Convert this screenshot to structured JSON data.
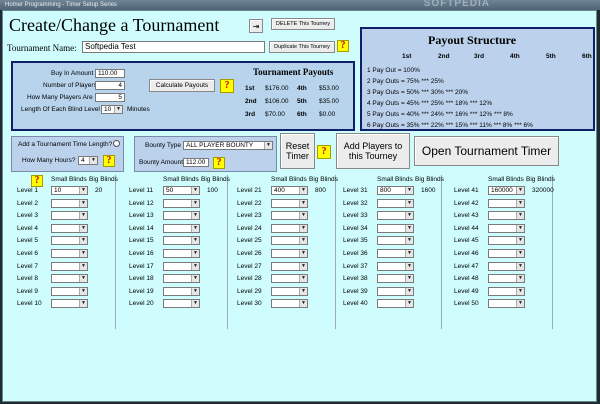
{
  "window": {
    "title": "Homer Programming - Timer Setup Series",
    "watermark": "SOFTPEDIA"
  },
  "header": {
    "title": "Create/Change a Tournament",
    "delete_label": "DELETE This Tourney",
    "duplicate_label": "Duplicate This Tourney",
    "name_label": "Tournament Name:",
    "name_value": "Softpedia Test"
  },
  "settings": {
    "buyin_label": "Buy In Amount",
    "buyin": "110.00",
    "players_label": "Number of Players",
    "players": "4",
    "paid_label": "How Many Players Are Paid",
    "paid": "5",
    "blind_label": "Length Of Each Blind Level",
    "blind": "10",
    "minutes": "Minutes",
    "calc_label": "Calculate Payouts"
  },
  "payouts": {
    "title": "Tournament Payouts",
    "rows": [
      {
        "p1": "1st",
        "v1": "$176.00",
        "p2": "4th",
        "v2": "$53.00"
      },
      {
        "p1": "2nd",
        "v1": "$106.00",
        "p2": "5th",
        "v2": "$35.00"
      },
      {
        "p1": "3rd",
        "v1": "$70.00",
        "p2": "6th",
        "v2": "$0.00"
      }
    ]
  },
  "structure": {
    "title": "Payout Structure",
    "cols": [
      "1st",
      "2nd",
      "3rd",
      "4th",
      "5th",
      "6th"
    ],
    "lines": [
      "1 Pay Out = 100%",
      "2 Pay Outs = 75% *** 25%",
      "3 Pay Outs = 50% *** 30% *** 20%",
      "4 Pay Outs = 45% *** 25% *** 18% *** 12%",
      "5 Pay Outs = 40% *** 24% *** 16% *** 12% *** 8%",
      "6 Pay Outs = 35% *** 22% *** 15% *** 11% *** 8% *** 6%"
    ]
  },
  "time": {
    "question": "Add a Tournament Time Length?",
    "hours_label": "How Many Hours?",
    "hours": "4"
  },
  "bounty": {
    "type_label": "Bounty Type",
    "type_value": "ALL PLAYER BOUNTY",
    "amount_label": "Bounty Amount",
    "amount": "112.00"
  },
  "actions": {
    "reset": "Reset Timer",
    "add_players": "Add Players to this Tourney",
    "open_timer": "Open Tournament Timer"
  },
  "levels": {
    "small_header": "Small Blinds",
    "big_header": "Big Blinds",
    "groups": [
      {
        "labels": [
          "Level 1",
          "Level 2",
          "Level 3",
          "Level 4",
          "Level 5",
          "Level 6",
          "Level 7",
          "Level 8",
          "Level 9",
          "Level 10"
        ],
        "small": "10",
        "big": "20"
      },
      {
        "labels": [
          "Level 11",
          "Level 12",
          "Level 13",
          "Level 14",
          "Level 15",
          "Level 16",
          "Level 17",
          "Level 18",
          "Level 19",
          "Level 20"
        ],
        "small": "50",
        "big": "100"
      },
      {
        "labels": [
          "Level 21",
          "Level 22",
          "Level 23",
          "Level 24",
          "Level 25",
          "Level 26",
          "Level 27",
          "Level 28",
          "Level 29",
          "Level 30"
        ],
        "small": "400",
        "big": "800"
      },
      {
        "labels": [
          "Level 31",
          "Level 32",
          "Level 33",
          "Level 34",
          "Level 35",
          "Level 36",
          "Level 37",
          "Level 38",
          "Level 39",
          "Level 40"
        ],
        "small": "800",
        "big": "1600"
      },
      {
        "labels": [
          "Level 41",
          "Level 42",
          "Level 43",
          "Level 44",
          "Level 45",
          "Level 46",
          "Level 47",
          "Level 48",
          "Level 49",
          "Level 50"
        ],
        "small": "160000",
        "big": "320000"
      }
    ]
  },
  "colors": {
    "bg": "#cffdfd",
    "panel": "#b7d4ec",
    "border": "#0f1f6a",
    "help": "#ffff00"
  }
}
